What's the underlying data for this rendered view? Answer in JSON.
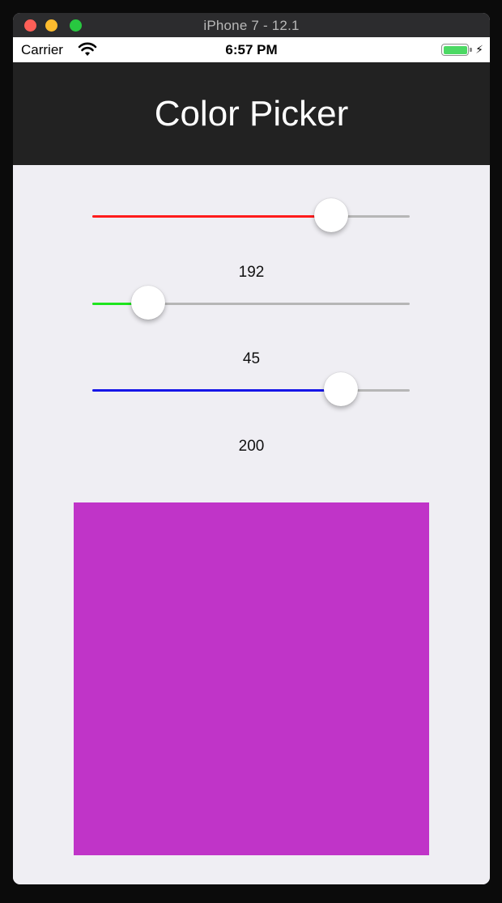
{
  "window": {
    "title": "iPhone 7 - 12.1"
  },
  "status_bar": {
    "carrier": "Carrier",
    "time": "6:57 PM",
    "wifi_icon": "wifi-icon",
    "battery_icon": "battery-icon",
    "charging_icon": "charging-bolt-icon"
  },
  "nav": {
    "title": "Color Picker"
  },
  "sliders": [
    {
      "channel": "red",
      "value": 192,
      "label": "192",
      "fraction": 0.753,
      "color": "#ff1b1b"
    },
    {
      "channel": "green",
      "value": 45,
      "label": "45",
      "fraction": 0.177,
      "color": "#1ee51e"
    },
    {
      "channel": "blue",
      "value": 200,
      "label": "200",
      "fraction": 0.784,
      "color": "#1616e8"
    }
  ],
  "preview": {
    "color": "#c034c8"
  }
}
